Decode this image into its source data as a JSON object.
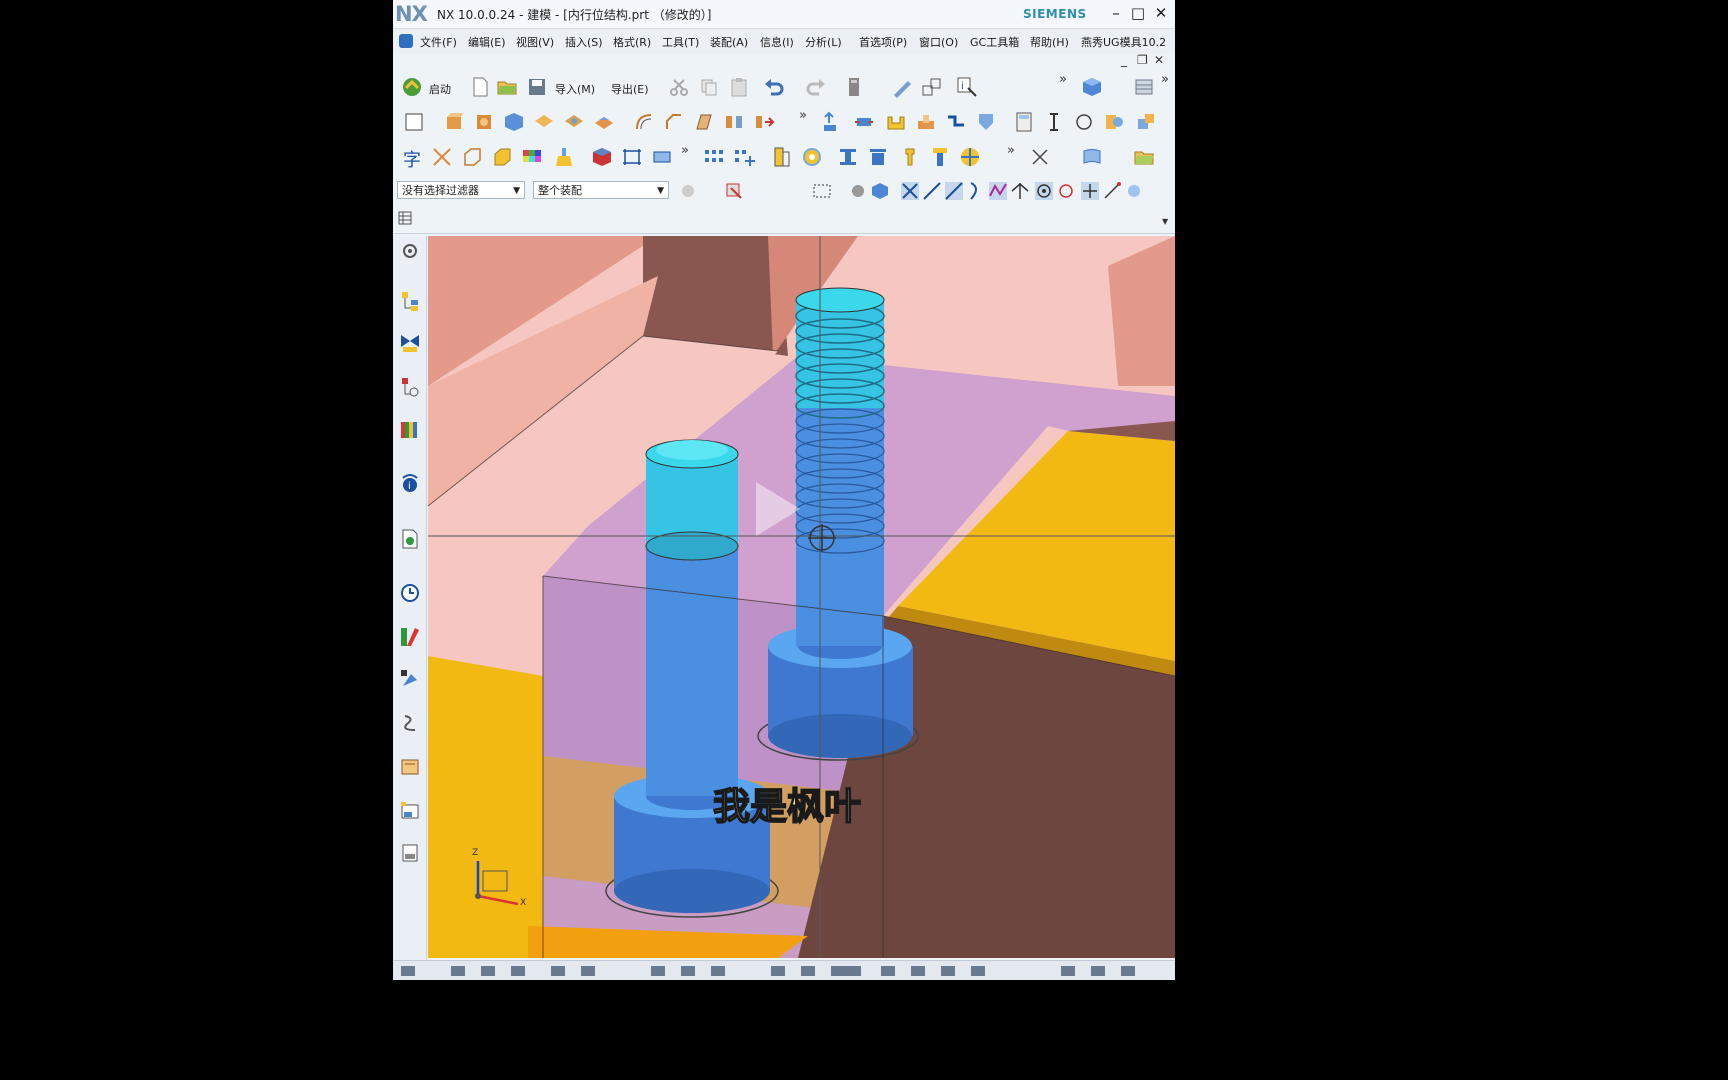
{
  "window": {
    "logo": "NX",
    "title": "NX 10.0.0.24 - 建模 - [内行位结构.prt （修改的）]",
    "brand": "SIEMENS",
    "minimize": "–",
    "maximize": "□",
    "close": "✕"
  },
  "menu": {
    "items": [
      "文件(F)",
      "编辑(E)",
      "视图(V)",
      "插入(S)",
      "格式(R)",
      "工具(T)",
      "装配(A)",
      "信息(I)",
      "分析(L)",
      "首选项(P)",
      "窗口(O)",
      "GC工具箱",
      "帮助(H)",
      "燕秀UG模具10.2"
    ]
  },
  "toolbar": {
    "start_label": "启动",
    "import_label": "导入(M)",
    "export_label": "导出(E)"
  },
  "selection": {
    "filter": "没有选择过滤器",
    "scope": "整个装配"
  },
  "viewport": {
    "subtitle": "我是枫叶",
    "axis_z": "Z",
    "axis_x": "X"
  },
  "colors": {
    "background_pink": "#f6c7c0",
    "plate_dark": "#8a5650",
    "plate_purple": "#c99ad0",
    "block_yellow": "#f2b913",
    "brown_block": "#6e4640",
    "screw_top": "#3ad8ea",
    "screw_body": "#4a8fe0"
  }
}
